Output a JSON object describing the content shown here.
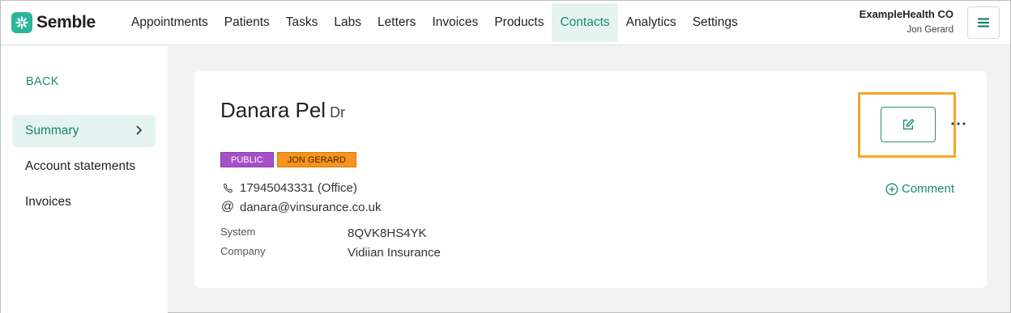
{
  "header": {
    "logo_text": "Semble",
    "nav": [
      "Appointments",
      "Patients",
      "Tasks",
      "Labs",
      "Letters",
      "Invoices",
      "Products",
      "Contacts",
      "Analytics",
      "Settings"
    ],
    "active_nav": "Contacts",
    "org_name": "ExampleHealth CO",
    "user_name": "Jon Gerard"
  },
  "sidebar": {
    "back_label": "BACK",
    "items": [
      {
        "label": "Summary",
        "active": true
      },
      {
        "label": "Account statements",
        "active": false
      },
      {
        "label": "Invoices",
        "active": false
      }
    ]
  },
  "contact": {
    "name": "Danara Pel",
    "title": "Dr",
    "tags": [
      "PUBLIC",
      "JON GERARD"
    ],
    "phone": "17945043331 (Office)",
    "email": "danara@vinsurance.co.uk",
    "fields": [
      {
        "label": "System",
        "value": "8QVK8HS4YK"
      },
      {
        "label": "Company",
        "value": "Vidiian Insurance"
      }
    ],
    "comment_label": "Comment"
  },
  "colors": {
    "accent": "#1a8a77",
    "brand": "#2bb59a",
    "tag_public": "#a64fc6",
    "tag_owner": "#f7931e",
    "highlight": "#f5a623"
  }
}
